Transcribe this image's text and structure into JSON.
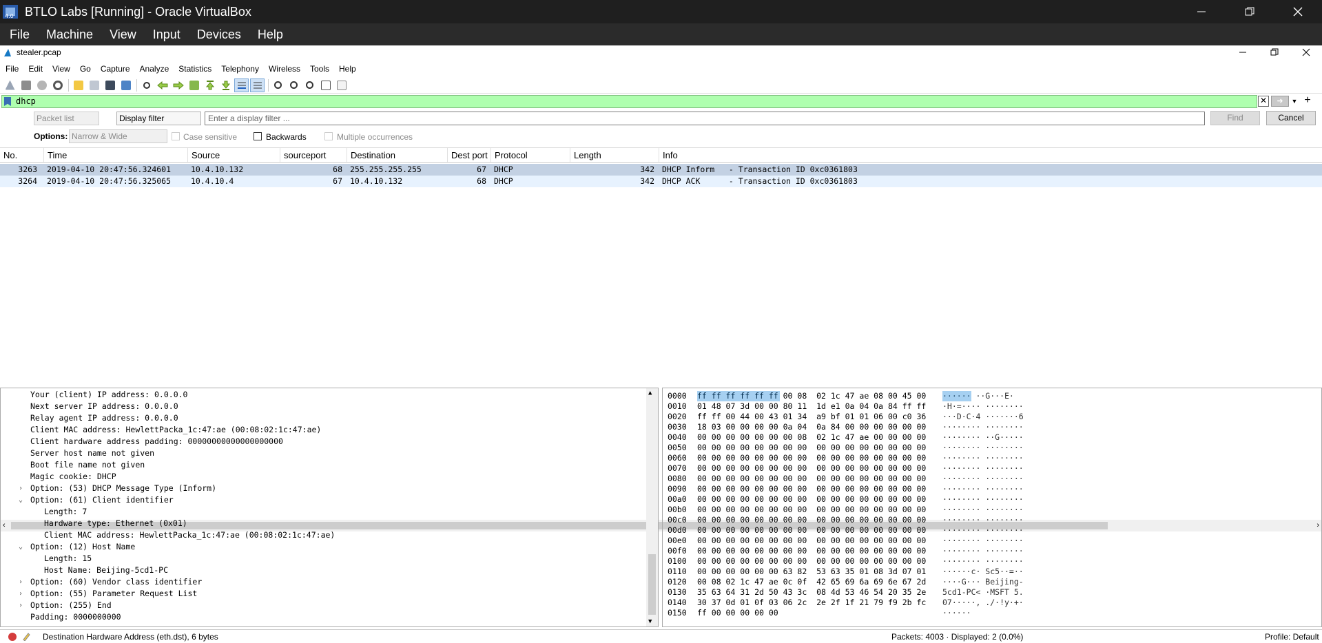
{
  "vbox": {
    "title": "BTLO Labs [Running] - Oracle VirtualBox",
    "menu": [
      "File",
      "Machine",
      "View",
      "Input",
      "Devices",
      "Help"
    ]
  },
  "ws": {
    "title": "stealer.pcap",
    "menu": [
      "File",
      "Edit",
      "View",
      "Go",
      "Capture",
      "Analyze",
      "Statistics",
      "Telephony",
      "Wireless",
      "Tools",
      "Help"
    ]
  },
  "filter": {
    "value": "dhcp"
  },
  "find": {
    "scope": "Packet list",
    "type": "Display filter",
    "placeholder": "Enter a display filter ...",
    "find_label": "Find",
    "cancel_label": "Cancel"
  },
  "options": {
    "label": "Options:",
    "charset": "Narrow & Wide",
    "case_sensitive": "Case sensitive",
    "backwards": "Backwards",
    "multiple": "Multiple occurrences"
  },
  "columns": [
    "No.",
    "Time",
    "Source",
    "sourceport",
    "Destination",
    "Dest port",
    "Protocol",
    "Length",
    "Info"
  ],
  "packets": [
    {
      "no": "3263",
      "time": "2019-04-10 20:47:56.324601",
      "src": "10.4.10.132",
      "sport": "68",
      "dst": "255.255.255.255",
      "dport": "67",
      "proto": "DHCP",
      "len": "342",
      "info": "DHCP Inform   - Transaction ID 0xc0361803"
    },
    {
      "no": "3264",
      "time": "2019-04-10 20:47:56.325065",
      "src": "10.4.10.4",
      "sport": "67",
      "dst": "10.4.10.132",
      "dport": "68",
      "proto": "DHCP",
      "len": "342",
      "info": "DHCP ACK      - Transaction ID 0xc0361803"
    }
  ],
  "details": [
    "Your (client) IP address: 0.0.0.0",
    "Next server IP address: 0.0.0.0",
    "Relay agent IP address: 0.0.0.0",
    "Client MAC address: HewlettPacka_1c:47:ae (00:08:02:1c:47:ae)",
    "Client hardware address padding: 00000000000000000000",
    "Server host name not given",
    "Boot file name not given",
    "Magic cookie: DHCP",
    "Option: (53) DHCP Message Type (Inform)",
    "Option: (61) Client identifier",
    "Length: 7",
    "Hardware type: Ethernet (0x01)",
    "Client MAC address: HewlettPacka_1c:47:ae (00:08:02:1c:47:ae)",
    "Option: (12) Host Name",
    "Length: 15",
    "Host Name: Beijing-5cd1-PC",
    "Option: (60) Vendor class identifier",
    "Option: (55) Parameter Request List",
    "Option: (255) End",
    "Padding: 0000000000"
  ],
  "bytes": {
    "offsets": [
      "0000",
      "0010",
      "0020",
      "0030",
      "0040",
      "0050",
      "0060",
      "0070",
      "0080",
      "0090",
      "00a0",
      "00b0",
      "00c0",
      "00d0",
      "00e0",
      "00f0",
      "0100",
      "0110",
      "0120",
      "0130",
      "0140",
      "0150"
    ],
    "hex": [
      "ff ff ff ff ff ff 00 08  02 1c 47 ae 08 00 45 00",
      "01 48 07 3d 00 00 80 11  1d e1 0a 04 0a 84 ff ff",
      "ff ff 00 44 00 43 01 34  a9 bf 01 01 06 00 c0 36",
      "18 03 00 00 00 00 0a 04  0a 84 00 00 00 00 00 00",
      "00 00 00 00 00 00 00 08  02 1c 47 ae 00 00 00 00",
      "00 00 00 00 00 00 00 00  00 00 00 00 00 00 00 00",
      "00 00 00 00 00 00 00 00  00 00 00 00 00 00 00 00",
      "00 00 00 00 00 00 00 00  00 00 00 00 00 00 00 00",
      "00 00 00 00 00 00 00 00  00 00 00 00 00 00 00 00",
      "00 00 00 00 00 00 00 00  00 00 00 00 00 00 00 00",
      "00 00 00 00 00 00 00 00  00 00 00 00 00 00 00 00",
      "00 00 00 00 00 00 00 00  00 00 00 00 00 00 00 00",
      "00 00 00 00 00 00 00 00  00 00 00 00 00 00 00 00",
      "00 00 00 00 00 00 00 00  00 00 00 00 00 00 00 00",
      "00 00 00 00 00 00 00 00  00 00 00 00 00 00 00 00",
      "00 00 00 00 00 00 00 00  00 00 00 00 00 00 00 00",
      "00 00 00 00 00 00 00 00  00 00 00 00 00 00 00 00",
      "00 00 00 00 00 00 63 82  53 63 35 01 08 3d 07 01",
      "00 08 02 1c 47 ae 0c 0f  42 65 69 6a 69 6e 67 2d",
      "35 63 64 31 2d 50 43 3c  08 4d 53 46 54 20 35 2e",
      "30 37 0d 01 0f 03 06 2c  2e 2f 1f 21 79 f9 2b fc",
      "ff 00 00 00 00 00"
    ],
    "ascii": [
      "······ ··G···E·",
      "·H·=···· ········",
      "···D·C·4 ·······6",
      "········ ········",
      "········ ··G·····",
      "········ ········",
      "········ ········",
      "········ ········",
      "········ ········",
      "········ ········",
      "········ ········",
      "········ ········",
      "········ ········",
      "········ ········",
      "········ ········",
      "········ ········",
      "········ ········",
      "······c· Sc5··=··",
      "····G··· Beijing-",
      "5cd1-PC< ·MSFT 5.",
      "07·····, ./·!y·+·",
      "······"
    ]
  },
  "status": {
    "field": "Destination Hardware Address (eth.dst), 6 bytes",
    "packets": "Packets: 4003 · Displayed: 2 (0.0%)",
    "profile": "Profile: Default"
  },
  "colors": {
    "row_selected": "#c3d1e3",
    "row_normal": "#e7f2fe",
    "filter_bg": "#afffaf",
    "hex_highlight": "#0078d7"
  }
}
